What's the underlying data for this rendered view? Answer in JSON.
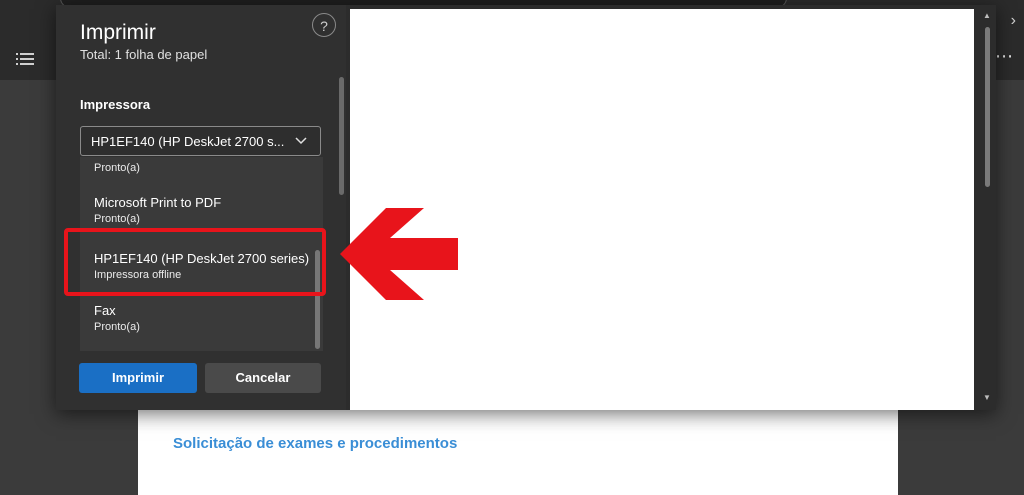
{
  "dialog": {
    "title": "Imprimir",
    "subtitle": "Total: 1 folha de papel",
    "help_label": "?",
    "printer_label": "Impressora",
    "selected_printer": "HP1EF140 (HP DeskJet 2700 s...",
    "printer_options": [
      {
        "name": "",
        "status": "Pronto(a)"
      },
      {
        "name": "Microsoft Print to PDF",
        "status": "Pronto(a)"
      },
      {
        "name": "HP1EF140 (HP DeskJet 2700 series)",
        "status": "Impressora offline",
        "highlighted": true
      },
      {
        "name": "Fax",
        "status": "Pronto(a)"
      }
    ],
    "print_button": "Imprimir",
    "cancel_button": "Cancelar"
  },
  "document": {
    "heading": "Solicitação de exames e procedimentos"
  },
  "annotation": {
    "highlight_color": "#e8141b",
    "arrow_color": "#e8141b"
  },
  "colors": {
    "primary_button": "#1a6fc5",
    "dialog_bg": "#303030",
    "document_link": "#3a8ed6"
  },
  "icons": [
    "list-icon",
    "more-options-icon",
    "chevron-right-icon",
    "help-icon",
    "chevron-down-icon",
    "scroll-up-icon",
    "scroll-down-icon",
    "red-arrow-icon"
  ]
}
